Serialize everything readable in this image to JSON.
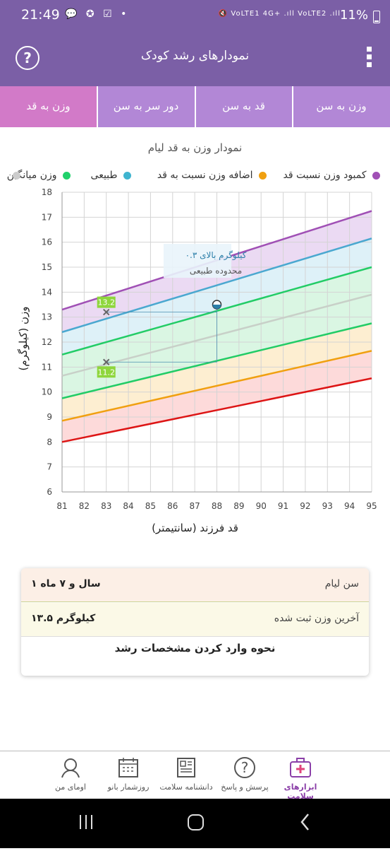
{
  "status_bar": {
    "time": "21:49",
    "left_icons": "💬 ✪ ☑ •",
    "right_icons": "🔇 VoLTE1 4G+ .ıll VoLTE2 .ıll",
    "battery": "11%"
  },
  "app_bar": {
    "title": "نمودارهای رشد کودک",
    "help_icon": "?",
    "menu_icon": "more-vertical-icon"
  },
  "tabs": [
    {
      "label": "وزن به سن",
      "active": false
    },
    {
      "label": "قد به سن",
      "active": false
    },
    {
      "label": "دور سر به سن",
      "active": false
    },
    {
      "label": "وزن به قد",
      "active": true
    }
  ],
  "chart_header": {
    "title": "نمودار وزن به قد لیام"
  },
  "legend": [
    {
      "label": "کمبود وزن نسبت قد",
      "color": "#a050b5"
    },
    {
      "label": "اضافه وزن نسبت به قد",
      "color": "#f0a010"
    },
    {
      "label": "طبیعی",
      "color": "#3fb4cf"
    },
    {
      "label": "وزن میانگین",
      "color": "#21d16b"
    },
    {
      "label": "",
      "color": "#cccccc"
    }
  ],
  "chart_data": {
    "type": "line",
    "xlabel": "قد فرزند (سانتیمتر)",
    "ylabel": "وزن (کیلوگرم)",
    "xlim": [
      81,
      95
    ],
    "ylim": [
      6,
      18
    ],
    "x_ticks": [
      81,
      82,
      83,
      84,
      85,
      86,
      87,
      88,
      89,
      90,
      91,
      92,
      93,
      94,
      95
    ],
    "y_ticks": [
      6,
      7,
      8,
      9,
      10,
      11,
      12,
      13,
      14,
      15,
      16,
      17,
      18
    ],
    "grid": true,
    "series": [
      {
        "color": "#a050b5",
        "fill": "#e8d3f1",
        "start": [
          81,
          13.3
        ],
        "end": [
          95,
          17.25
        ]
      },
      {
        "color": "#4aa8d0",
        "fill": "#d8eff7",
        "start": [
          81,
          12.4
        ],
        "end": [
          95,
          16.15
        ]
      },
      {
        "color": "#22cc66",
        "fill": "#d3f5de",
        "start": [
          81,
          11.5
        ],
        "end": [
          95,
          15.0
        ]
      },
      {
        "color": "#c8d0c8",
        "fill": "#d3f5de",
        "start": [
          81,
          10.65
        ],
        "end": [
          95,
          13.9
        ]
      },
      {
        "color": "#22cc66",
        "fill": "#fdebc9",
        "start": [
          81,
          9.75
        ],
        "end": [
          95,
          12.75
        ]
      },
      {
        "color": "#f0a010",
        "fill": "#fdd3d3",
        "start": [
          81,
          8.85
        ],
        "end": [
          95,
          11.65
        ]
      },
      {
        "color": "#dd1515",
        "fill": null,
        "start": [
          81,
          8.0
        ],
        "end": [
          95,
          10.55
        ]
      }
    ],
    "markers": [
      {
        "x": 83,
        "y": 13.2,
        "label": "13.2"
      },
      {
        "x": 83,
        "y": 11.2,
        "label": "11.2"
      }
    ],
    "point": {
      "x": 88,
      "y": 13.5
    },
    "annotation": {
      "line1": "۰.۳ کیلوگرم بالای",
      "line2": "محدوده طبیعی"
    }
  },
  "info": {
    "age_label": "سن لیام",
    "age_value": "۱ سال و ۷ ماه",
    "weight_label": "آخرین وزن ثبت شده",
    "weight_value": "۱۳.۵ کیلوگرم",
    "howto": "نحوه وارد کردن مشخصات رشد"
  },
  "bottom_nav": [
    {
      "label": "ابزارهای سلامت",
      "icon": "medical-kit-icon",
      "active": true
    },
    {
      "label": "پرسش و پاسخ",
      "icon": "question-icon",
      "active": false
    },
    {
      "label": "دانشنامه سلامت",
      "icon": "newspaper-icon",
      "active": false
    },
    {
      "label": "روزشمار بانو",
      "icon": "calendar-icon",
      "active": false
    },
    {
      "label": "اومای من",
      "icon": "user-icon",
      "active": false
    }
  ]
}
